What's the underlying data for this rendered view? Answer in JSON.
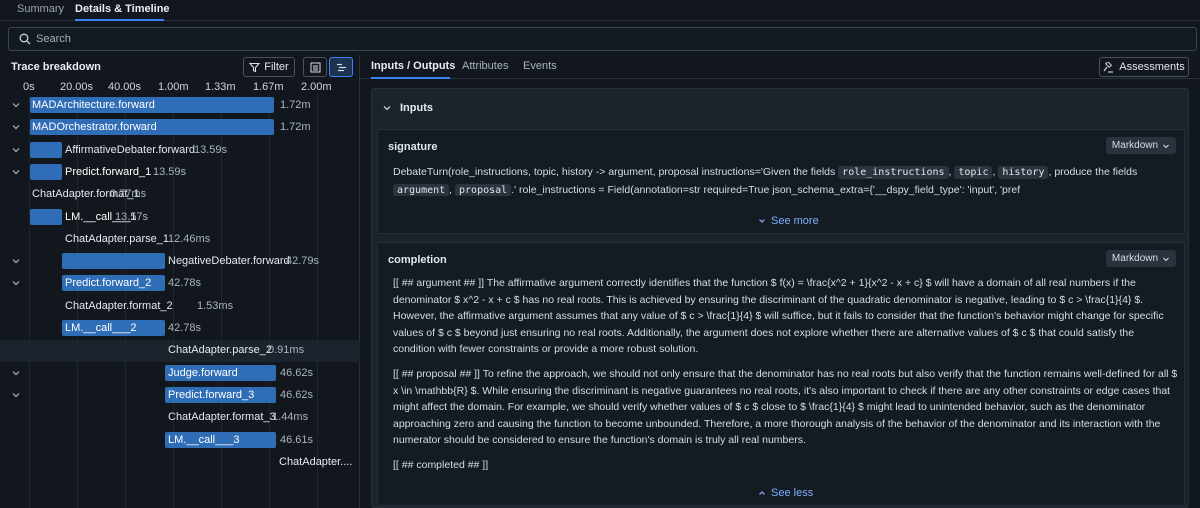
{
  "top_tabs": [
    {
      "label": "Summary"
    },
    {
      "label": "Details & Timeline",
      "active": true
    }
  ],
  "search": {
    "placeholder": "Search"
  },
  "trace": {
    "title": "Trace breakdown",
    "filter_label": "Filter",
    "axis_ticks": [
      "0s",
      "20.00s",
      "40.00s",
      "1.00m",
      "1.33m",
      "1.67m",
      "2.00m"
    ],
    "rows": [
      {
        "label": "MADArchitecture.forward",
        "duration": "1.72m",
        "expandable": true
      },
      {
        "label": "MADOrchestrator.forward",
        "duration": "1.72m",
        "expandable": true
      },
      {
        "label": "AffirmativeDebater.forward",
        "duration": "13.59s",
        "expandable": true
      },
      {
        "label": "Predict.forward_1",
        "duration": "13.59s",
        "expandable": true
      },
      {
        "label": "ChatAdapter.format_1",
        "duration": "0.77ms",
        "expandable": false
      },
      {
        "label": "LM.__call___1",
        "duration": "13.57s",
        "expandable": false
      },
      {
        "label": "ChatAdapter.parse_1",
        "duration": "12.46ms",
        "expandable": false
      },
      {
        "label": "NegativeDebater.forward",
        "duration": "42.79s",
        "expandable": true
      },
      {
        "label": "Predict.forward_2",
        "duration": "42.78s",
        "expandable": true
      },
      {
        "label": "ChatAdapter.format_2",
        "duration": "1.53ms",
        "expandable": false
      },
      {
        "label": "LM.__call___2",
        "duration": "42.78s",
        "expandable": false
      },
      {
        "label": "ChatAdapter.parse_2",
        "duration": "0.91ms",
        "expandable": false,
        "selected": true
      },
      {
        "label": "Judge.forward",
        "duration": "46.62s",
        "expandable": true
      },
      {
        "label": "Predict.forward_3",
        "duration": "46.62s",
        "expandable": true
      },
      {
        "label": "ChatAdapter.format_3",
        "duration": "1.44ms",
        "expandable": false
      },
      {
        "label": "LM.__call___3",
        "duration": "46.61s",
        "expandable": false
      },
      {
        "label": "ChatAdapter....",
        "duration": "",
        "expandable": false
      }
    ]
  },
  "detail_tabs": [
    {
      "label": "Inputs / Outputs",
      "active": true
    },
    {
      "label": "Attributes"
    },
    {
      "label": "Events"
    }
  ],
  "assessments_label": "Assessments",
  "inputs": {
    "title": "Inputs",
    "signature": {
      "title": "signature",
      "format": "Markdown",
      "parts": [
        "DebateTurn(role_instructions, topic, history -> argument, proposal instructions='Given the fields ",
        "role_instructions",
        ", ",
        "topic",
        ", ",
        "history",
        ", produce the fields ",
        "argument",
        ", ",
        "proposal",
        ".' role_instructions = Field(annotation=str required=True json_schema_extra={'__dspy_field_type': 'input', 'pref"
      ],
      "toggle": "See more"
    },
    "completion": {
      "title": "completion",
      "format": "Markdown",
      "paragraphs": [
        "[[ ## argument ## ]] The affirmative argument correctly identifies that the function $ f(x) = \\frac{x^2 + 1}{x^2 - x + c} $ will have a domain of all real numbers if the denominator $ x^2 - x + c $ has no real roots. This is achieved by ensuring the discriminant of the quadratic denominator is negative, leading to $ c > \\frac{1}{4} $. However, the affirmative argument assumes that any value of $ c > \\frac{1}{4} $ will suffice, but it fails to consider that the function's behavior might change for specific values of $ c $ beyond just ensuring no real roots. Additionally, the argument does not explore whether there are alternative values of $ c $ that could satisfy the condition with fewer constraints or provide a more robust solution.",
        "[[ ## proposal ## ]] To refine the approach, we should not only ensure that the denominator has no real roots but also verify that the function remains well-defined for all $ x \\in \\mathbb{R} $. While ensuring the discriminant is negative guarantees no real roots, it's also important to check if there are any other constraints or edge cases that might affect the domain. For example, we should verify whether values of $ c $ close to $ \\frac{1}{4} $ might lead to unintended behavior, such as the denominator approaching zero and causing the function to become unbounded. Therefore, a more thorough analysis of the behavior of the denominator and its interaction with the numerator should be considered to ensure the function's domain is truly all real numbers.",
        "[[ ## completed ## ]]"
      ],
      "toggle": "See less"
    }
  },
  "colors": {
    "accent": "#3b82f6",
    "bar": "#2f6db6",
    "background": "#11171d"
  }
}
